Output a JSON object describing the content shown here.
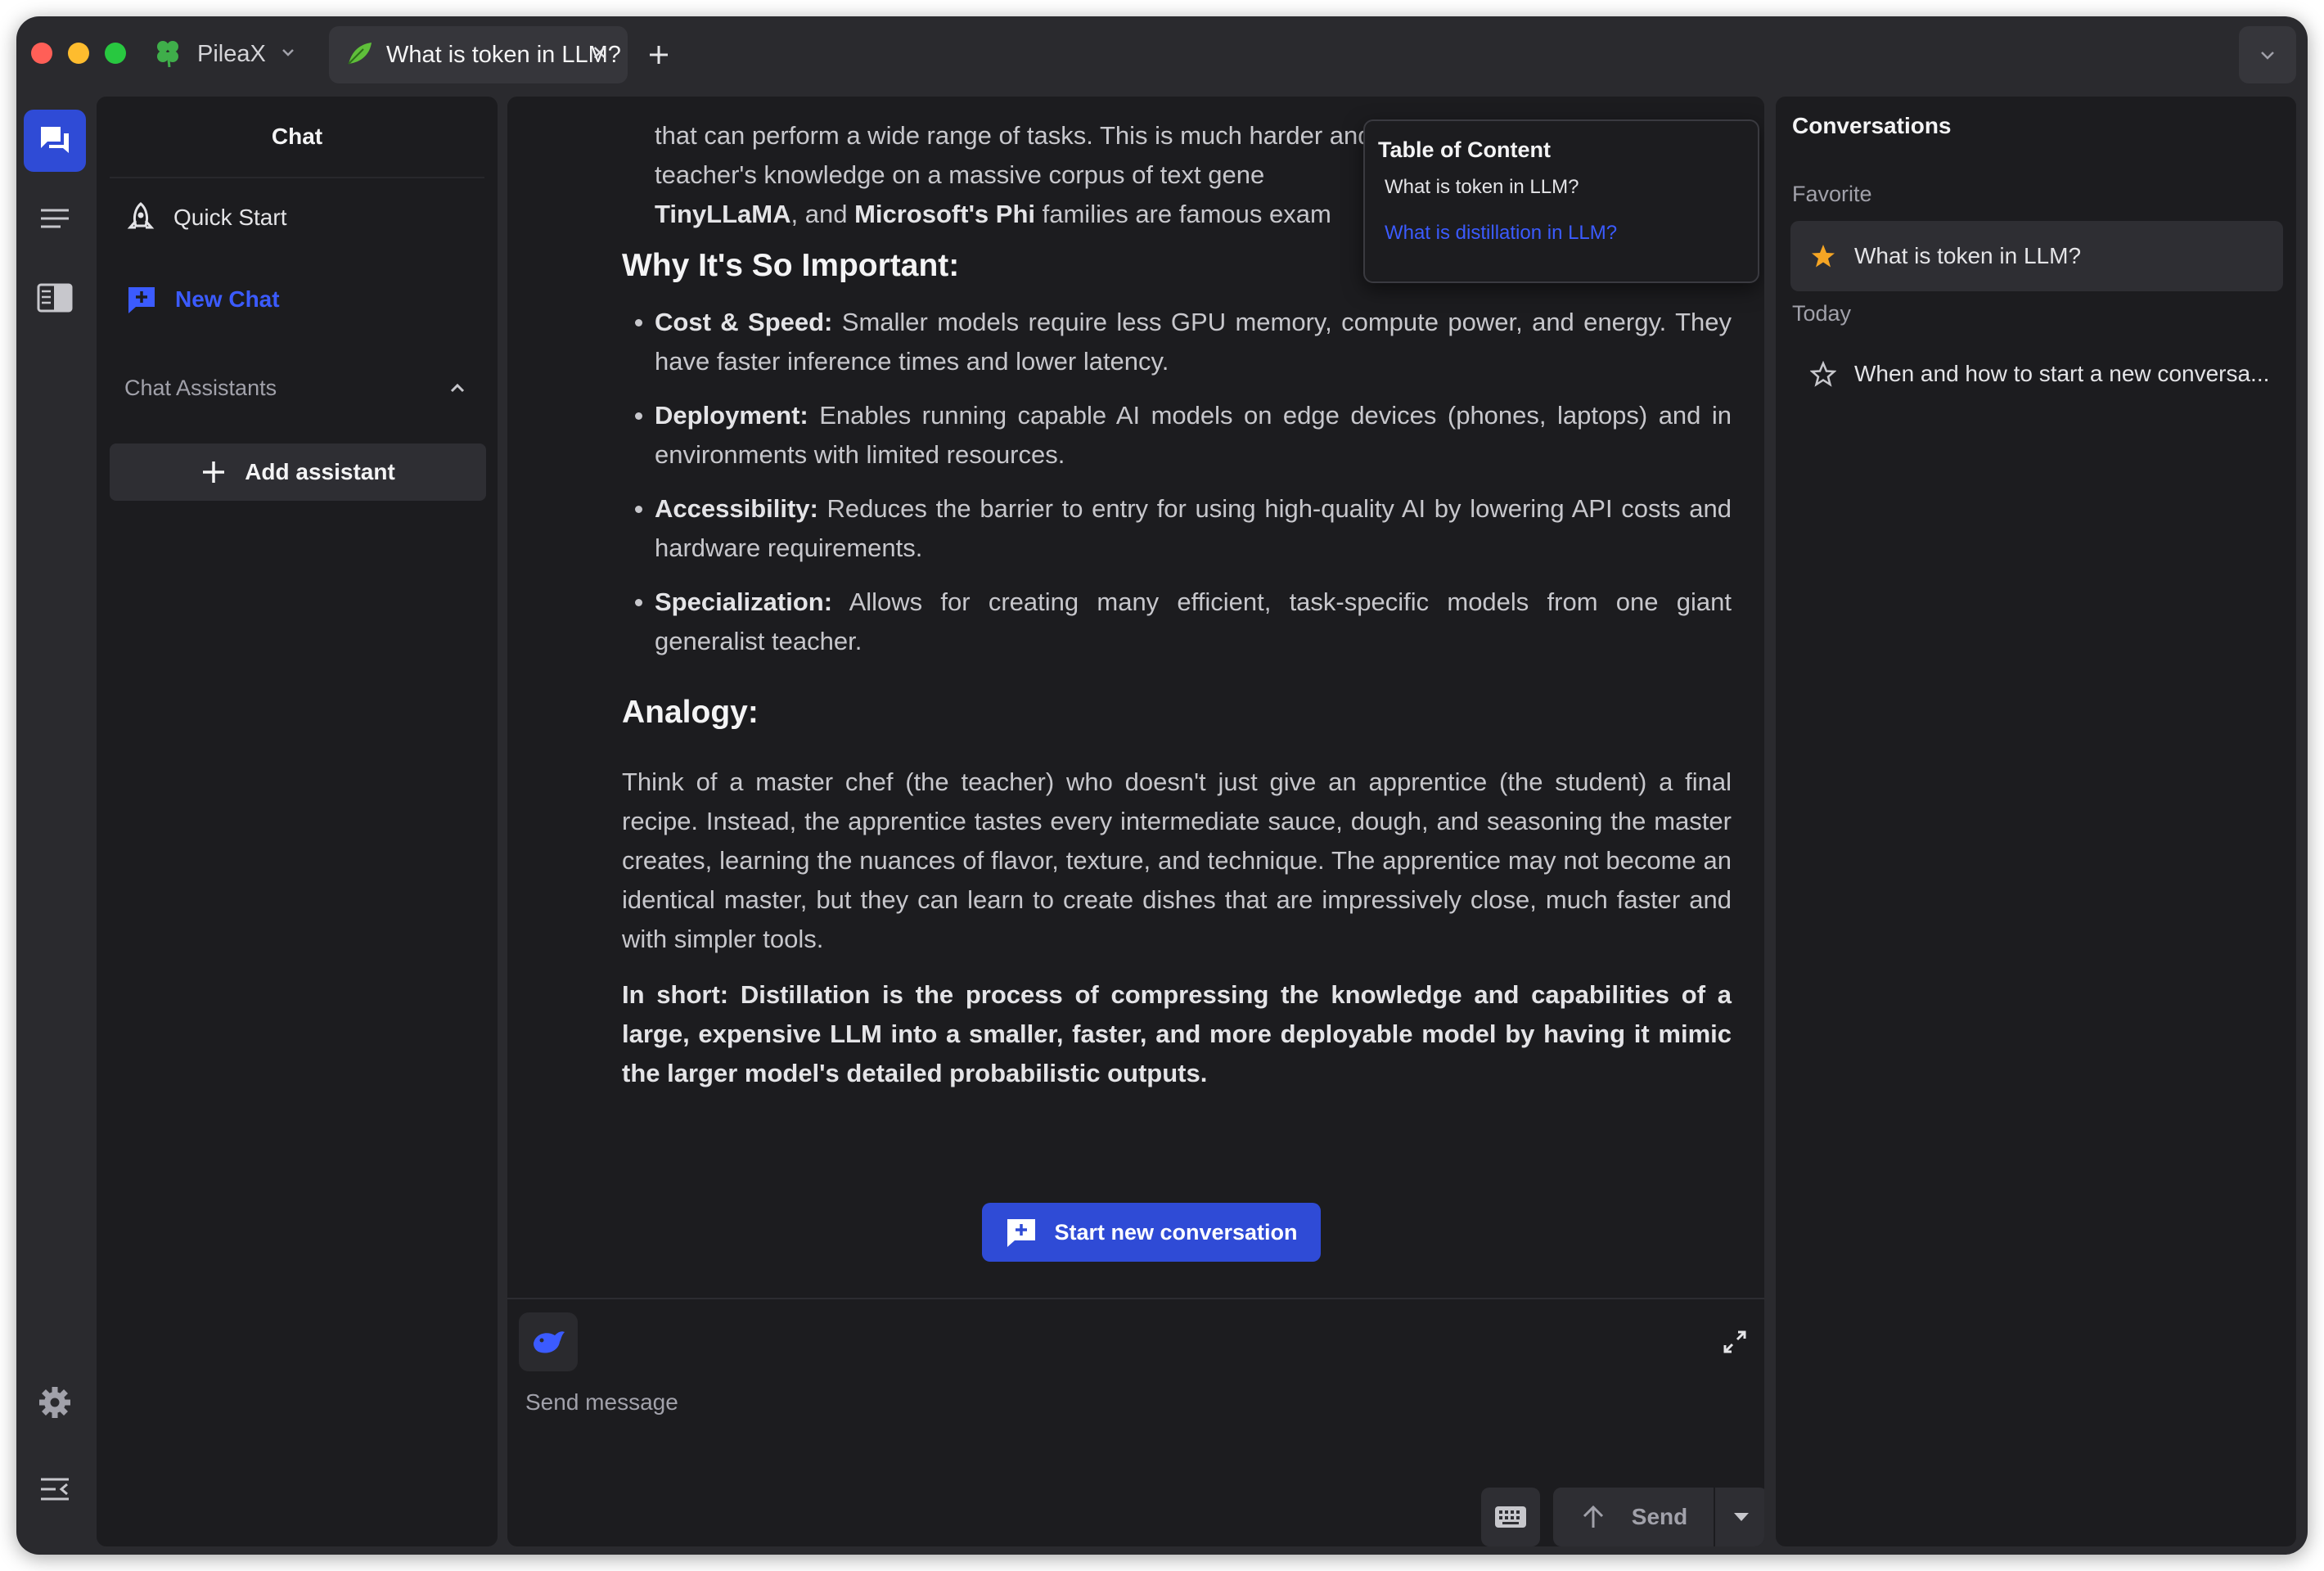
{
  "app": {
    "name": "PileaX"
  },
  "tabs": [
    {
      "title": "What is token in LLM?"
    }
  ],
  "sidebar": {
    "title": "Chat",
    "quick_start": "Quick Start",
    "new_chat": "New Chat",
    "assistants_label": "Chat Assistants",
    "add_assistant": "Add assistant"
  },
  "content": {
    "intro_cut": "that can perform a wide range of tasks. This is much harder and often involves distilling the",
    "intro_line2": "teacher's knowledge on a massive corpus of text gene",
    "intro_b1": "TinyLLaMA",
    "intro_mid": ", and ",
    "intro_b2": "Microsoft's Phi",
    "intro_tail": " families are famous exam",
    "why_heading": "Why It's So Important:",
    "bullets": [
      {
        "label": "Cost & Speed:",
        "text": " Smaller models require less GPU memory, compute power, and energy. They have faster inference times and lower latency."
      },
      {
        "label": "Deployment:",
        "text": " Enables running capable AI models on edge devices (phones, laptops) and in environments with limited resources."
      },
      {
        "label": "Accessibility:",
        "text": " Reduces the barrier to entry for using high-quality AI by lowering API costs and hardware requirements."
      },
      {
        "label": "Specialization:",
        "text": " Allows for creating many efficient, task-specific models from one giant generalist teacher."
      }
    ],
    "analogy_heading": "Analogy:",
    "analogy_text": "Think of a master chef (the teacher) who doesn't just give an apprentice (the student) a final recipe. Instead, the apprentice tastes every intermediate sauce, dough, and seasoning the master creates, learning the nuances of flavor, texture, and technique. The apprentice may not become an identical master, but they can learn to create dishes that are impressively close, much faster and with simpler tools.",
    "summary": "In short: Distillation is the process of compressing the knowledge and capabilities of a large, expensive LLM into a smaller, faster, and more deployable model by having it mimic the larger model's detailed probabilistic outputs."
  },
  "toc": {
    "title": "Table of Content",
    "items": [
      "What is token in LLM?",
      "What is distillation in LLM?"
    ]
  },
  "actions": {
    "start_new": "Start new conversation"
  },
  "composer": {
    "placeholder": "Send message",
    "send": "Send"
  },
  "conversations": {
    "title": "Conversations",
    "favorite_label": "Favorite",
    "today_label": "Today",
    "favorite": [
      "What is token in LLM?"
    ],
    "today": [
      "When and how to start a new conversa..."
    ]
  },
  "colors": {
    "accent": "#2f4bd6",
    "link": "#3b5bff",
    "star": "#f5a524",
    "background": "#1c1c1f"
  },
  "icons": {
    "brand": "clover-icon",
    "tab": "leaf-icon",
    "rail": [
      "chat-icon",
      "list-icon",
      "book-icon",
      "gear-icon",
      "collapse-icon"
    ],
    "composer": [
      "whale-icon",
      "expand-icon",
      "keyboard-icon",
      "arrow-up-icon",
      "caret-down-icon"
    ]
  }
}
